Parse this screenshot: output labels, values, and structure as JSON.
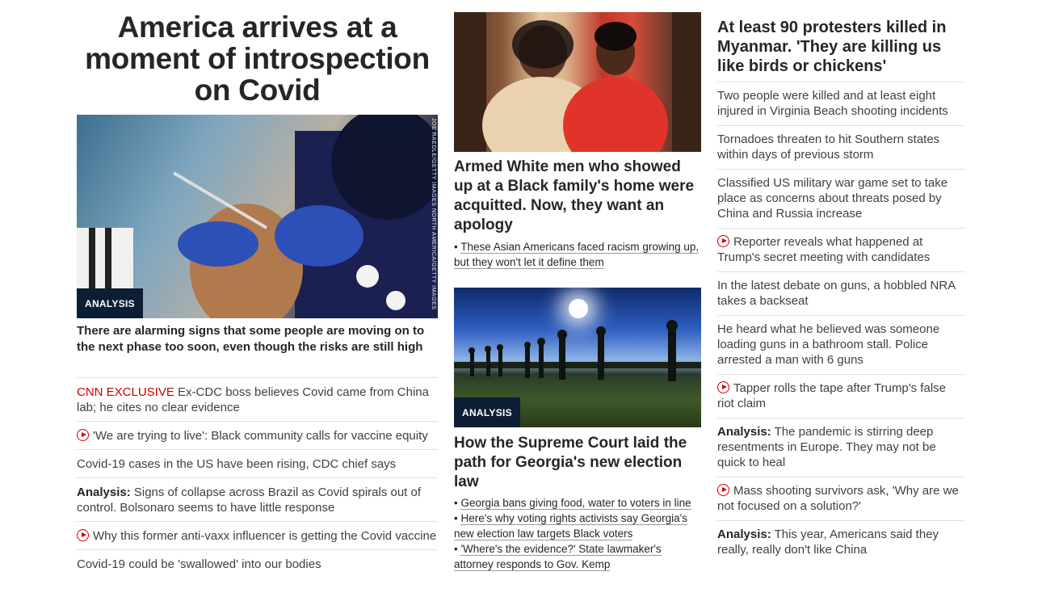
{
  "col1": {
    "headline": "America arrives at a moment of introspection on Covid",
    "hero_badge": "ANALYSIS",
    "hero_credit": "JOE RAEDLE/GETTY IMAGES NORTH AMERICA/GETTY IMAGES",
    "hero_subhead": "There are alarming signs that some people are moving on to the next phase too soon, even though the risks are still high",
    "items": [
      {
        "label": "CNN EXCLUSIVE",
        "text": " Ex-CDC boss believes Covid came from China lab; he cites no clear evidence"
      },
      {
        "text": "'We are trying to live': Black community calls for vaccine equity"
      },
      {
        "text": "Covid-19 cases in the US have been rising, CDC chief says"
      },
      {
        "label": "Analysis:",
        "text": " Signs of collapse across Brazil as Covid spirals out of control. Bolsonaro seems to have little response"
      },
      {
        "text": "Why this former anti-vaxx influencer is getting the Covid vaccine"
      },
      {
        "text": "Covid-19 could be 'swallowed' into our bodies"
      }
    ]
  },
  "col2": {
    "story1": {
      "title": "Armed White men who showed up at a Black family's home were acquitted. Now, they want an apology",
      "bullets": [
        "These Asian Americans faced racism growing up, but they won't let it define them"
      ]
    },
    "story2": {
      "badge": "ANALYSIS",
      "title": "How the Supreme Court laid the path for Georgia's new election law",
      "bullets": [
        "Georgia bans giving food, water to voters in line",
        "Here's why voting rights activists say Georgia's new election law targets Black voters",
        "'Where's the evidence?' State lawmaker's attorney responds to Gov. Kemp"
      ]
    }
  },
  "col3": {
    "title": "At least 90 protesters killed in Myanmar. 'They are killing us like birds or chickens'",
    "items": [
      {
        "text": "Two people were killed and at least eight injured in Virginia Beach shooting incidents"
      },
      {
        "text": "Tornadoes threaten to hit Southern states within days of previous storm"
      },
      {
        "text": "Classified US military war game set to take place as concerns about threats posed by China and Russia increase"
      },
      {
        "text": "Reporter reveals what happened at Trump's secret meeting with candidates"
      },
      {
        "text": "In the latest debate on guns, a hobbled NRA takes a backseat"
      },
      {
        "text": "He heard what he believed was someone loading guns in a bathroom stall. Police arrested a man with 6 guns"
      },
      {
        "text": "Tapper rolls the tape after Trump's false riot claim"
      },
      {
        "label": "Analysis:",
        "text": " The pandemic is stirring deep resentments in Europe. They may not be quick to heal"
      },
      {
        "text": "Mass shooting survivors ask, 'Why are we not focused on a solution?'"
      },
      {
        "label": "Analysis:",
        "text": " This year, Americans said they really, really don't like China"
      }
    ]
  }
}
